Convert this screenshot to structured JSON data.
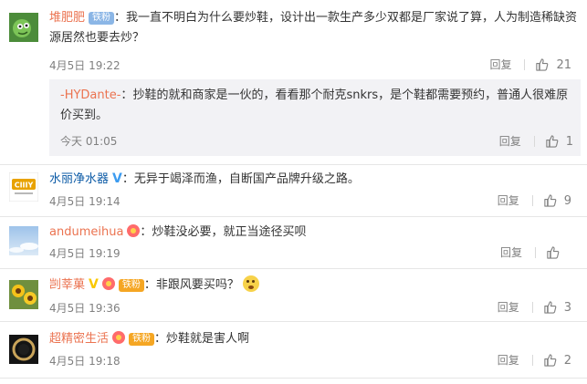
{
  "comments": [
    {
      "author": "堆肥肥",
      "badge": "铁粉",
      "text": "我一直不明白为什么要炒鞋，设计出一款生产多少双都是厂家说了算，人为制造稀缺资源居然也要去炒？",
      "time": "4月5日 19:22",
      "reply_label": "回复",
      "likes": "21",
      "reply": {
        "author": "-HYDante-",
        "text": "抄鞋的就和商家是一伙的，看看那个耐克snkrs，是个鞋都需要预约，普通人很难原价买到。",
        "time": "今天 01:05",
        "reply_label": "回复",
        "likes": "1"
      }
    },
    {
      "author": "水丽净水器",
      "verified": "V",
      "avatar_text": "CIIIY",
      "text": "无异于竭泽而渔，自断国产品牌升级之路。",
      "time": "4月5日 19:14",
      "reply_label": "回复",
      "likes": "9"
    },
    {
      "author": "andumeihua",
      "text": "炒鞋没必要，就正当途径买呗",
      "time": "4月5日 19:19",
      "reply_label": "回复",
      "likes": ""
    },
    {
      "author": "剀莘菓",
      "verified": "V",
      "badge": "铁粉",
      "text": "非跟风要买吗？",
      "time": "4月5日 19:36",
      "reply_label": "回复",
      "likes": "3"
    },
    {
      "author": "超精密生活",
      "badge": "铁粉",
      "text": "炒鞋就是害人啊",
      "time": "4月5日 19:18",
      "reply_label": "回复",
      "likes": "2"
    }
  ],
  "colors": {
    "author_name": "#eb7350",
    "brand_name": "#0b5aa6",
    "badge_blue": "#8bb6e6",
    "badge_orange": "#f5a623",
    "reply_bg": "#f2f2f5",
    "meta_gray": "#808080"
  },
  "icons": {
    "like": "thumbs-up-icon",
    "emoji": "thinking-face-emoji",
    "verified": "v-verified-icon",
    "medal": "fan-medal-icon"
  }
}
